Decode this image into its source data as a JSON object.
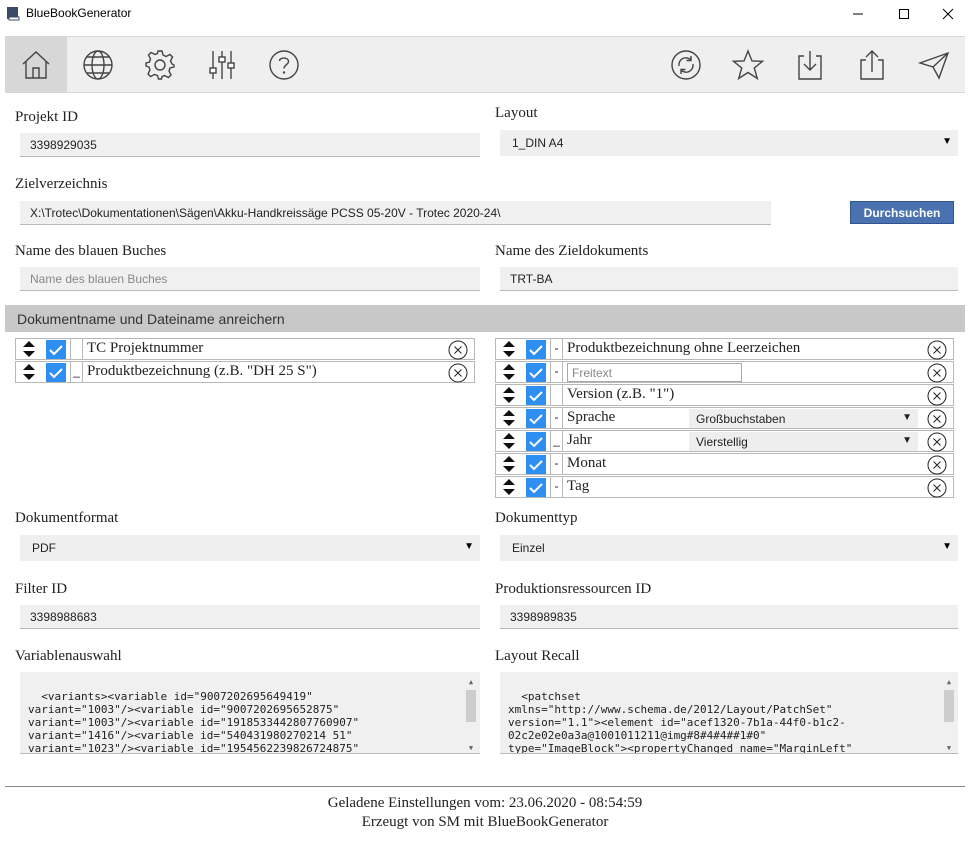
{
  "window": {
    "title": "BlueBookGenerator"
  },
  "toolbar": {
    "left_icons": [
      "home-icon",
      "globe-icon",
      "gear-icon",
      "sliders-icon",
      "help-icon"
    ],
    "right_icons": [
      "sync-icon",
      "star-icon",
      "download-icon",
      "share-icon",
      "send-icon"
    ]
  },
  "form": {
    "projekt_id": {
      "label": "Projekt ID",
      "value": "3398929035"
    },
    "layout": {
      "label": "Layout",
      "value": "1_DIN A4"
    },
    "zielverzeichnis": {
      "label": "Zielverzeichnis",
      "value": "X:\\Trotec\\Dokumentationen\\Sägen\\Akku-Handkreissäge PCSS 05-20V - Trotec 2020-24\\",
      "browse_label": "Durchsuchen"
    },
    "blue_book_name": {
      "label": "Name des blauen Buches",
      "placeholder": "Name des blauen Buches"
    },
    "target_doc_name": {
      "label": "Name des Zieldokuments",
      "value": "TRT-BA"
    }
  },
  "enrich": {
    "title": "Dokumentname und Dateiname anreichern",
    "left_rows": [
      {
        "separator": "",
        "name": "TC Projektnummer"
      },
      {
        "separator": "_",
        "name": "Produktbezeichnung (z.B. \"DH 25 S\")"
      }
    ],
    "right_rows": [
      {
        "separator": "-",
        "name": "Produktbezeichnung ohne Leerzeichen"
      },
      {
        "separator": "-",
        "input_placeholder": "Freitext"
      },
      {
        "separator": "",
        "name": "Version (z.B. \"1\")"
      },
      {
        "separator": "-",
        "name": "Sprache",
        "select": "Großbuchstaben"
      },
      {
        "separator": "_",
        "name": "Jahr",
        "select": "Vierstellig"
      },
      {
        "separator": "-",
        "name": "Monat"
      },
      {
        "separator": "-",
        "name": "Tag"
      }
    ]
  },
  "format": {
    "dokumentformat": {
      "label": "Dokumentformat",
      "value": "PDF"
    },
    "dokumenttyp": {
      "label": "Dokumenttyp",
      "value": "Einzel"
    },
    "filter_id": {
      "label": "Filter ID",
      "value": "3398988683"
    },
    "ressourcen_id": {
      "label": "Produktionsressourcen ID",
      "value": "3398989835"
    }
  },
  "variables": {
    "label": "Variablenauswahl",
    "text": "<variants><variable id=\"9007202695649419\"\nvariant=\"1003\"/><variable id=\"9007202695652875\"\nvariant=\"1003\"/><variable id=\"1918533442807760907\"\nvariant=\"1416\"/><variable id=\"540431980270214 51\"\nvariant=\"1023\"/><variable id=\"1954562239826724875\""
  },
  "layout_recall": {
    "label": "Layout Recall",
    "text": "<patchset\nxmlns=\"http://www.schema.de/2012/Layout/PatchSet\"\nversion=\"1.1\"><element id=\"acef1320-7b1a-44f0-b1c2-\n02c2e02e0a3a@1001011211@img#8#4#4##1#0\"\ntype=\"ImageBlock\"><propertyChanged name=\"MarginLeft\""
  },
  "footer": {
    "loaded": "Geladene Einstellungen vom: 23.06.2020 - 08:54:59",
    "created": "Erzeugt von SM mit BlueBookGenerator"
  },
  "colors": {
    "accent": "#2e8ef2",
    "button": "#4a72b0",
    "section": "#c8c8c8"
  }
}
